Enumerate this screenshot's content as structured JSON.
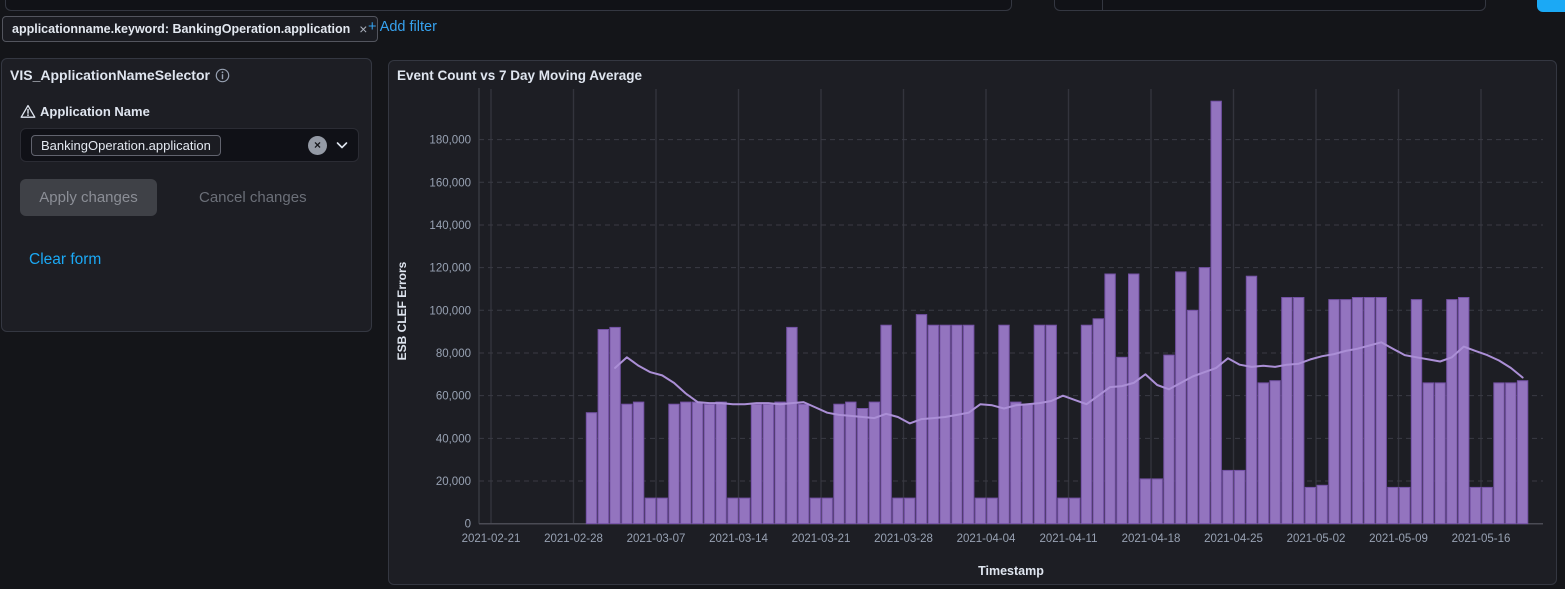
{
  "top_bar": {
    "note": "search query bar, date range picker and update button cut off at top edge"
  },
  "colors": {
    "accent_blue": "#1ba9f5",
    "link_blue": "#36a2ef",
    "bar_fill": "#9374bf",
    "bar_stroke": "#7452a5",
    "line": "#ab8fd6",
    "panel_bg": "#1d1e24",
    "page_bg": "#141519"
  },
  "filter_bar": {
    "pill_label": "applicationname.keyword: BankingOperation.application",
    "remove_glyph": "×",
    "add_filter_label": "+ Add filter"
  },
  "selector_panel": {
    "title": "VIS_ApplicationNameSelector",
    "field_label": "Application Name",
    "selected_value": "BankingOperation.application",
    "clear_glyph": "×",
    "apply_label": "Apply changes",
    "cancel_label": "Cancel changes",
    "clear_form_label": "Clear form"
  },
  "chart_data": {
    "type": "bar",
    "title": "Event Count vs 7 Day Moving Average",
    "xlabel": "Timestamp",
    "ylabel": "ESB CLEF Errors",
    "ylim": [
      0,
      200000
    ],
    "grid": true,
    "legend_position": "none",
    "y_ticks": [
      0,
      20000,
      40000,
      60000,
      80000,
      100000,
      120000,
      140000,
      160000,
      180000
    ],
    "x_tick_labels": [
      "2021-02-21",
      "2021-02-28",
      "2021-03-07",
      "2021-03-14",
      "2021-03-21",
      "2021-03-28",
      "2021-04-04",
      "2021-04-11",
      "2021-04-18",
      "2021-04-25",
      "2021-05-02",
      "2021-05-09",
      "2021-05-16"
    ],
    "series": [
      {
        "name": "Event Count",
        "type": "bar",
        "start_date": "2021-03-01",
        "interval": "1d",
        "values": [
          52000,
          91000,
          92000,
          56000,
          57000,
          12000,
          12000,
          56000,
          57000,
          57000,
          56000,
          57000,
          12000,
          12000,
          56000,
          56000,
          57000,
          92000,
          56000,
          12000,
          12000,
          56000,
          57000,
          54000,
          57000,
          93000,
          12000,
          12000,
          98000,
          93000,
          93000,
          93000,
          93000,
          12000,
          12000,
          93000,
          57000,
          56000,
          93000,
          93000,
          12000,
          12000,
          93000,
          96000,
          117000,
          78000,
          117000,
          21000,
          21000,
          79000,
          118000,
          100000,
          120000,
          198000,
          25000,
          25000,
          116000,
          66000,
          67000,
          106000,
          106000,
          17000,
          18000,
          105000,
          105000,
          106000,
          106000,
          106000,
          17000,
          17000,
          105000,
          66000,
          66000,
          105000,
          106000,
          17000,
          17000,
          66000,
          66000,
          67000
        ]
      },
      {
        "name": "7 Day Moving Average",
        "type": "line",
        "start_date": "2021-03-01",
        "interval": "1d",
        "values": [
          null,
          null,
          73000,
          78000,
          74000,
          71000,
          69500,
          66000,
          61000,
          57000,
          56500,
          56500,
          56000,
          56000,
          56500,
          56500,
          56000,
          56500,
          57000,
          54500,
          52000,
          51000,
          50500,
          50000,
          49500,
          51500,
          50000,
          47000,
          49000,
          49500,
          50000,
          51000,
          52000,
          56000,
          55500,
          54000,
          55500,
          56000,
          56500,
          57500,
          60000,
          58000,
          56000,
          60000,
          64000,
          64500,
          66000,
          70000,
          65000,
          63000,
          66000,
          69000,
          71000,
          73000,
          77500,
          74500,
          73500,
          74000,
          73500,
          74500,
          75000,
          77000,
          78500,
          79500,
          81000,
          82000,
          83500,
          85000,
          82000,
          79000,
          78000,
          77000,
          76000,
          78000,
          83000,
          81000,
          79000,
          76500,
          73000,
          68500
        ]
      }
    ]
  }
}
